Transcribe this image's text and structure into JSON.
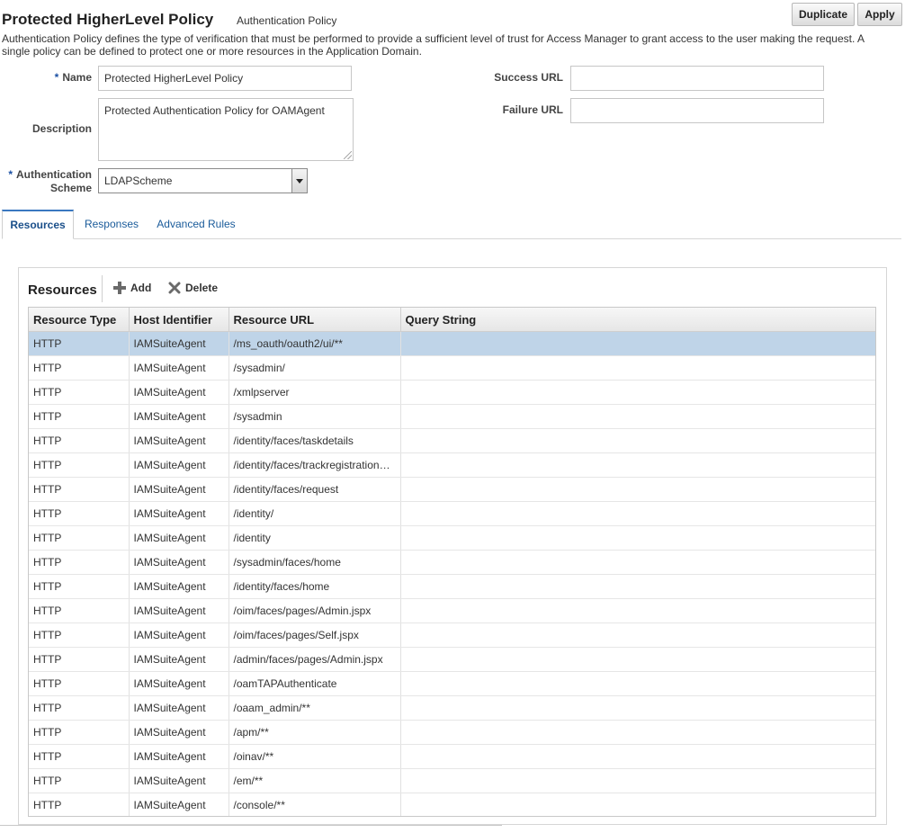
{
  "header": {
    "title": "Protected HigherLevel Policy",
    "subtitle": "Authentication Policy",
    "duplicate_label": "Duplicate",
    "apply_label": "Apply"
  },
  "description_text": "Authentication Policy defines the type of verification that must be performed to provide a sufficient level of trust for Access Manager to grant access to the user making the request. A single policy can be defined to protect one or more resources in the Application Domain.",
  "form": {
    "required_marker": "*",
    "name_label": "Name",
    "name_value": "Protected HigherLevel Policy",
    "description_label": "Description",
    "description_value": "Protected Authentication Policy for OAMAgent",
    "auth_scheme_label_line1": "Authentication",
    "auth_scheme_label_line2": "Scheme",
    "auth_scheme_value": "LDAPScheme",
    "success_url_label": "Success URL",
    "success_url_value": "",
    "failure_url_label": "Failure URL",
    "failure_url_value": ""
  },
  "tabs": [
    {
      "label": "Resources",
      "active": true
    },
    {
      "label": "Responses",
      "active": false
    },
    {
      "label": "Advanced Rules",
      "active": false
    }
  ],
  "resources": {
    "title": "Resources",
    "add_label": "Add",
    "delete_label": "Delete",
    "columns": [
      "Resource Type",
      "Host Identifier",
      "Resource URL",
      "Query String"
    ],
    "rows": [
      {
        "type": "HTTP",
        "host": "IAMSuiteAgent",
        "url": "/ms_oauth/oauth2/ui/**",
        "query": "",
        "selected": true
      },
      {
        "type": "HTTP",
        "host": "IAMSuiteAgent",
        "url": "/sysadmin/",
        "query": ""
      },
      {
        "type": "HTTP",
        "host": "IAMSuiteAgent",
        "url": "/xmlpserver",
        "query": ""
      },
      {
        "type": "HTTP",
        "host": "IAMSuiteAgent",
        "url": "/sysadmin",
        "query": ""
      },
      {
        "type": "HTTP",
        "host": "IAMSuiteAgent",
        "url": "/identity/faces/taskdetails",
        "query": ""
      },
      {
        "type": "HTTP",
        "host": "IAMSuiteAgent",
        "url": "/identity/faces/trackregistration…",
        "query": ""
      },
      {
        "type": "HTTP",
        "host": "IAMSuiteAgent",
        "url": "/identity/faces/request",
        "query": ""
      },
      {
        "type": "HTTP",
        "host": "IAMSuiteAgent",
        "url": "/identity/",
        "query": ""
      },
      {
        "type": "HTTP",
        "host": "IAMSuiteAgent",
        "url": "/identity",
        "query": ""
      },
      {
        "type": "HTTP",
        "host": "IAMSuiteAgent",
        "url": "/sysadmin/faces/home",
        "query": ""
      },
      {
        "type": "HTTP",
        "host": "IAMSuiteAgent",
        "url": "/identity/faces/home",
        "query": ""
      },
      {
        "type": "HTTP",
        "host": "IAMSuiteAgent",
        "url": "/oim/faces/pages/Admin.jspx",
        "query": ""
      },
      {
        "type": "HTTP",
        "host": "IAMSuiteAgent",
        "url": "/oim/faces/pages/Self.jspx",
        "query": ""
      },
      {
        "type": "HTTP",
        "host": "IAMSuiteAgent",
        "url": "/admin/faces/pages/Admin.jspx",
        "query": ""
      },
      {
        "type": "HTTP",
        "host": "IAMSuiteAgent",
        "url": "/oamTAPAuthenticate",
        "query": ""
      },
      {
        "type": "HTTP",
        "host": "IAMSuiteAgent",
        "url": "/oaam_admin/**",
        "query": ""
      },
      {
        "type": "HTTP",
        "host": "IAMSuiteAgent",
        "url": "/apm/**",
        "query": ""
      },
      {
        "type": "HTTP",
        "host": "IAMSuiteAgent",
        "url": "/oinav/**",
        "query": ""
      },
      {
        "type": "HTTP",
        "host": "IAMSuiteAgent",
        "url": "/em/**",
        "query": ""
      },
      {
        "type": "HTTP",
        "host": "IAMSuiteAgent",
        "url": "/console/**",
        "query": ""
      }
    ]
  },
  "colors": {
    "accent": "#1a5b9a",
    "selected_row": "#bfd4e8",
    "required_marker": "#1a4fa3"
  }
}
